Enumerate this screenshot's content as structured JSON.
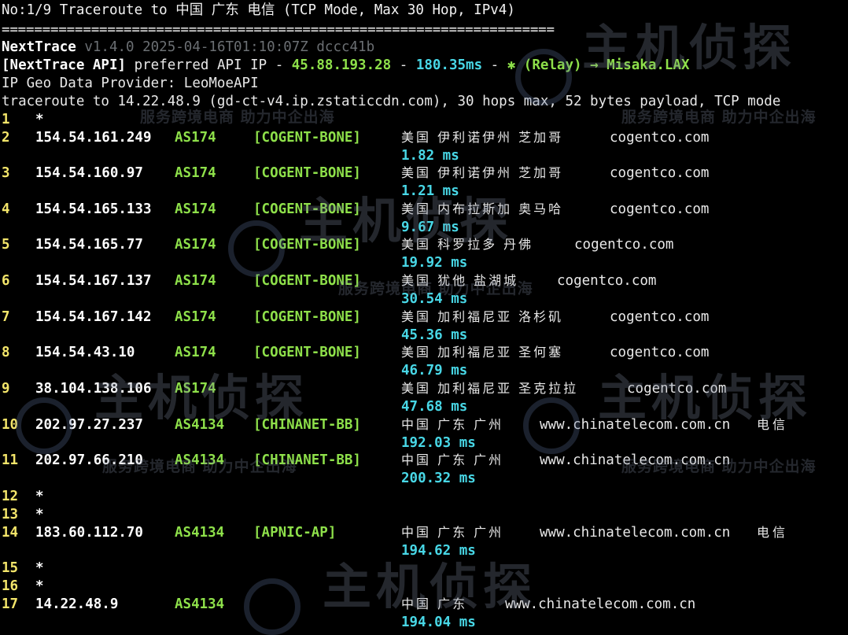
{
  "header": {
    "title": "No:1/9 Traceroute to 中国 广东 电信 (TCP Mode, Max 30 Hop, IPv4)",
    "separator": "====================================================================",
    "app_name": "NextTrace",
    "app_version": " v1.4.0 2025-04-16T01:10:07Z dccc41b",
    "api_tag": "[NextTrace API]",
    "api_text": " preferred API IP - ",
    "api_ip": "45.88.193.28",
    "api_dash": " - ",
    "api_latency": "180.35ms",
    "api_dash2": " - ",
    "relay": "✱ (Relay) → Misaka.LAX",
    "geo_provider": "IP Geo Data Provider: LeoMoeAPI",
    "traceroute_line": "traceroute to 14.22.48.9 (gd-ct-v4.ip.zstaticcdn.com), 30 hops max, 52 bytes payload, TCP mode"
  },
  "hops": [
    {
      "num": "1",
      "star": "*"
    },
    {
      "num": "2",
      "ip": "154.54.161.249",
      "asn": "AS174",
      "tag": "[COGENT-BONE]",
      "geo": "美国 伊利诺伊州 芝加哥",
      "domain": "cogentco.com",
      "rtt": "1.82 ms"
    },
    {
      "num": "3",
      "ip": "154.54.160.97",
      "asn": "AS174",
      "tag": "[COGENT-BONE]",
      "geo": "美国 伊利诺伊州 芝加哥",
      "domain": "cogentco.com",
      "rtt": "1.21 ms"
    },
    {
      "num": "4",
      "ip": "154.54.165.133",
      "asn": "AS174",
      "tag": "[COGENT-BONE]",
      "geo": "美国 内布拉斯加 奥马哈",
      "domain": "cogentco.com",
      "rtt": "9.67 ms"
    },
    {
      "num": "5",
      "ip": "154.54.165.77",
      "asn": "AS174",
      "tag": "[COGENT-BONE]",
      "geo": "美国 科罗拉多 丹佛",
      "domain": "cogentco.com",
      "rtt": "19.92 ms"
    },
    {
      "num": "6",
      "ip": "154.54.167.137",
      "asn": "AS174",
      "tag": "[COGENT-BONE]",
      "geo": "美国 犹他 盐湖城",
      "domain": "cogentco.com",
      "rtt": "30.54 ms"
    },
    {
      "num": "7",
      "ip": "154.54.167.142",
      "asn": "AS174",
      "tag": "[COGENT-BONE]",
      "geo": "美国 加利福尼亚 洛杉矶",
      "domain": "cogentco.com",
      "rtt": "45.36 ms"
    },
    {
      "num": "8",
      "ip": "154.54.43.10",
      "asn": "AS174",
      "tag": "[COGENT-BONE]",
      "geo": "美国 加利福尼亚 圣何塞",
      "domain": "cogentco.com",
      "rtt": "46.79 ms"
    },
    {
      "num": "9",
      "ip": "38.104.138.106",
      "asn": "AS174",
      "tag": "",
      "geo": "美国 加利福尼亚 圣克拉拉",
      "domain": "cogentco.com",
      "rtt": "47.68 ms"
    },
    {
      "num": "10",
      "ip": "202.97.27.237",
      "asn": "AS4134",
      "tag": "[CHINANET-BB]",
      "geo": "中国 广东 广州",
      "domain": "www.chinatelecom.com.cn",
      "isp": "电信",
      "rtt": "192.03 ms"
    },
    {
      "num": "11",
      "ip": "202.97.66.210",
      "asn": "AS4134",
      "tag": "[CHINANET-BB]",
      "geo": "中国 广东 广州",
      "domain": "www.chinatelecom.com.cn",
      "rtt": "200.32 ms"
    },
    {
      "num": "12",
      "star": "*"
    },
    {
      "num": "13",
      "star": "*"
    },
    {
      "num": "14",
      "ip": "183.60.112.70",
      "asn": "AS4134",
      "tag": "[APNIC-AP]",
      "geo": "中国 广东 广州",
      "domain": "www.chinatelecom.com.cn",
      "isp": "电信",
      "rtt": "194.62 ms"
    },
    {
      "num": "15",
      "star": "*"
    },
    {
      "num": "16",
      "star": "*"
    },
    {
      "num": "17",
      "ip": "14.22.48.9",
      "asn": "AS4134",
      "tag": "",
      "geo": "中国 广东",
      "domain": "www.chinatelecom.com.cn",
      "rtt": "194.04 ms"
    }
  ],
  "watermark": {
    "big": "主机侦探",
    "small": "服务跨境电商 助力中企出海"
  },
  "colors": {
    "background": "#000000",
    "hop_number": "#f3e56a",
    "asn": "#8ee04a",
    "rtt": "#48d7e6"
  }
}
